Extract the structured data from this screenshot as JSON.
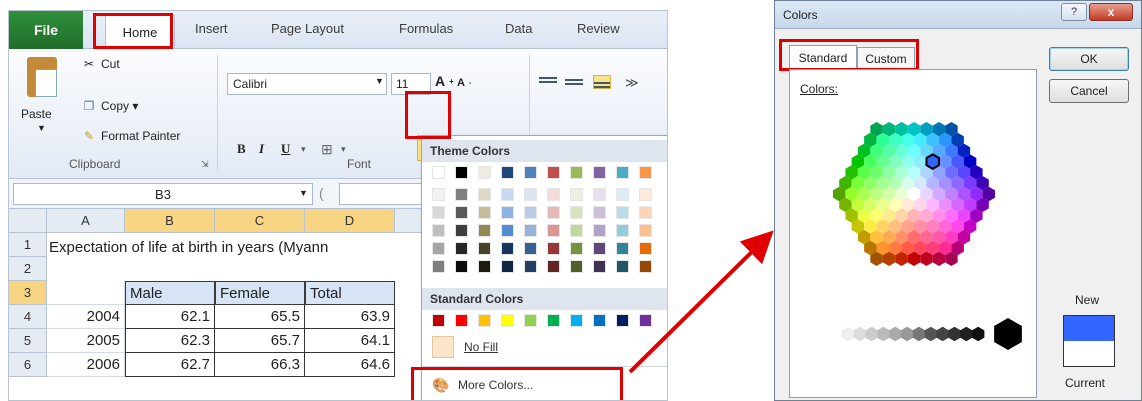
{
  "excel": {
    "tabs": {
      "file": "File",
      "home": "Home",
      "insert": "Insert",
      "page_layout": "Page Layout",
      "formulas": "Formulas",
      "data": "Data",
      "review": "Review"
    },
    "clipboard": {
      "paste": "Paste",
      "cut": "Cut",
      "copy": "Copy ▾",
      "format_painter": "Format Painter",
      "group_label": "Clipboard"
    },
    "font": {
      "name": "Calibri",
      "size": "11",
      "group_label": "Font",
      "bold": "B",
      "italic": "I",
      "underline": "U",
      "font_color": "A"
    },
    "name_box": "B3",
    "columns": [
      "A",
      "B",
      "C",
      "D"
    ],
    "rows": [
      "1",
      "2",
      "3",
      "4",
      "5",
      "6"
    ],
    "title": "Expectation of life at birth in years (Myann",
    "table": {
      "headers": [
        "Male",
        "Female",
        "Total"
      ],
      "rows": [
        {
          "year": "2004",
          "male": "62.1",
          "female": "65.5",
          "total": "63.9"
        },
        {
          "year": "2005",
          "male": "62.3",
          "female": "65.7",
          "total": "64.1"
        },
        {
          "year": "2006",
          "male": "62.7",
          "female": "66.3",
          "total": "64.6"
        }
      ]
    },
    "dropdown": {
      "theme_colors": "Theme Colors",
      "standard_colors": "Standard Colors",
      "no_fill": "No Fill",
      "more_colors": "More Colors...",
      "theme_top": [
        "#ffffff",
        "#000000",
        "#eeece1",
        "#1f497d",
        "#4f81bd",
        "#c0504d",
        "#9bbb59",
        "#8064a2",
        "#4bacc6",
        "#f79646"
      ],
      "theme_shades": [
        [
          "#f2f2f2",
          "#7f7f7f",
          "#ddd9c3",
          "#c6d9f0",
          "#dbe5f1",
          "#f2dcdb",
          "#ebf1dd",
          "#e5e0ec",
          "#dbeef3",
          "#fdeada"
        ],
        [
          "#d8d8d8",
          "#595959",
          "#c4bd97",
          "#8db3e2",
          "#b8cce4",
          "#e5b9b7",
          "#d7e3bc",
          "#ccc1d9",
          "#b7dde8",
          "#fbd5b5"
        ],
        [
          "#bfbfbf",
          "#3f3f3f",
          "#938953",
          "#548dd4",
          "#95b3d7",
          "#d99694",
          "#c3d69b",
          "#b2a2c7",
          "#92cddc",
          "#fac08f"
        ],
        [
          "#a5a5a5",
          "#262626",
          "#494429",
          "#17365d",
          "#366092",
          "#953734",
          "#76923c",
          "#5f497a",
          "#31859b",
          "#e36c09"
        ],
        [
          "#7f7f7f",
          "#0c0c0c",
          "#1d1b10",
          "#0f243e",
          "#244061",
          "#632423",
          "#4f6128",
          "#3f3151",
          "#205867",
          "#974806"
        ]
      ],
      "standard": [
        "#c00000",
        "#ff0000",
        "#ffc000",
        "#ffff00",
        "#92d050",
        "#00b050",
        "#00b0f0",
        "#0070c0",
        "#002060",
        "#7030a0"
      ]
    }
  },
  "dialog": {
    "title": "Colors",
    "help": "?",
    "close": "x",
    "tabs": {
      "standard": "Standard",
      "custom": "Custom"
    },
    "colors_label": "Colors:",
    "ok": "OK",
    "cancel": "Cancel",
    "new_label": "New",
    "current_label": "Current",
    "new_color": "#3366ff",
    "current_color": "#ffffff"
  }
}
